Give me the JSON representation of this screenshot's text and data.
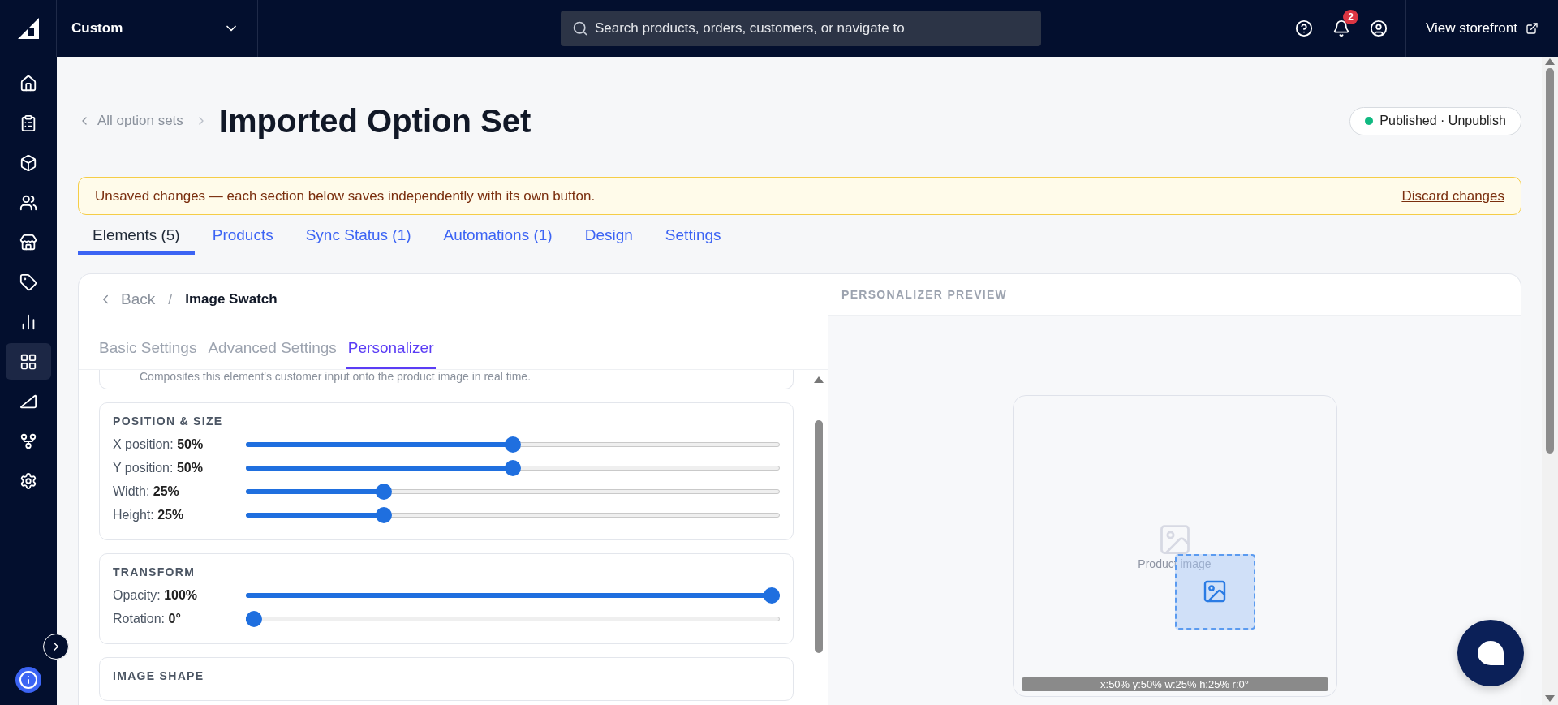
{
  "top_bar": {
    "store": "Custom",
    "search": {
      "placeholder": "Search products, orders, customers, or navigate to"
    },
    "notification_count": "2",
    "storefront_link": "View storefront"
  },
  "sidebar": {
    "items": [
      {
        "selected": false
      },
      {
        "selected": false
      },
      {
        "selected": false
      },
      {
        "selected": false
      },
      {
        "selected": false
      },
      {
        "selected": false
      },
      {
        "selected": false
      },
      {
        "selected": true
      },
      {
        "selected": false
      },
      {
        "selected": false
      },
      {
        "selected": false
      }
    ]
  },
  "header": {
    "breadcrumb": "All option sets",
    "title": "Imported Option Set",
    "status": {
      "label": "Published",
      "separator": "·",
      "action": "Unpublish",
      "published": true
    }
  },
  "banner": {
    "message": "Unsaved changes — each section below saves independently with its own button.",
    "action": "Discard changes"
  },
  "tabs": [
    {
      "label": "Elements (5)",
      "selected": true
    },
    {
      "label": "Products",
      "selected": false
    },
    {
      "label": "Sync Status (1)",
      "selected": false
    },
    {
      "label": "Automations (1)",
      "selected": false
    },
    {
      "label": "Design",
      "selected": false
    },
    {
      "label": "Settings",
      "selected": false
    }
  ],
  "editor": {
    "back": "Back",
    "separator": "/",
    "element": "Image Swatch",
    "subtabs": [
      {
        "label": "Basic Settings",
        "selected": false
      },
      {
        "label": "Advanced Settings",
        "selected": false
      },
      {
        "label": "Personalizer",
        "selected": true
      }
    ],
    "description": "Composites this element's customer input onto the product image in real time.",
    "sections": [
      {
        "title": "POSITION & SIZE",
        "sliders": [
          {
            "label": "X position:",
            "value": "50%",
            "level": 0.5
          },
          {
            "label": "Y position:",
            "value": "50%",
            "level": 0.5
          },
          {
            "label": "Width:",
            "value": "25%",
            "level": 0.25
          },
          {
            "label": "Height:",
            "value": "25%",
            "level": 0.25
          }
        ]
      },
      {
        "title": "TRANSFORM",
        "sliders": [
          {
            "label": "Opacity:",
            "value": "100%",
            "level": 1
          },
          {
            "label": "Rotation:",
            "value": "0°",
            "level": 0
          }
        ]
      },
      {
        "title": "IMAGE SHAPE"
      }
    ]
  },
  "preview": {
    "title": "PERSONALIZER PREVIEW",
    "placeholder": "Product image",
    "caption": "x:50% y:50% w:25% h:25% r:0°"
  }
}
